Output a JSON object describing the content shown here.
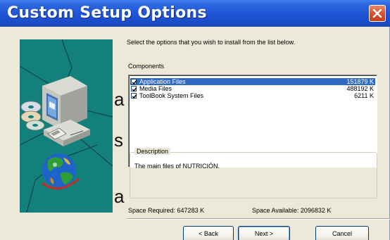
{
  "window": {
    "title": "Custom Setup Options"
  },
  "page": {
    "letters": [
      "a",
      "s",
      "a"
    ]
  },
  "setup": {
    "intro": "Select the options that you wish to install from the list below.",
    "components_label": "Components",
    "components": [
      {
        "name": "Application Files",
        "size": "151879 K",
        "checked": true,
        "selected": true
      },
      {
        "name": "Media Files",
        "size": "488192 K",
        "checked": true,
        "selected": false
      },
      {
        "name": "ToolBook System Files",
        "size": "6211 K",
        "checked": true,
        "selected": false
      }
    ],
    "description_label": "Description",
    "description": "The main files of NUTRICIÓN.",
    "space_required": "Space Required:  647283 K",
    "space_available": "Space Available:  2096832 K"
  },
  "buttons": {
    "back": "< Back",
    "next": "Next >",
    "cancel": "Cancel"
  },
  "colors": {
    "titlebar": "#1f54d4",
    "panel": "#13807b",
    "dialog": "#ece9d8",
    "selection": "#316ac5",
    "close": "#d95a36"
  }
}
